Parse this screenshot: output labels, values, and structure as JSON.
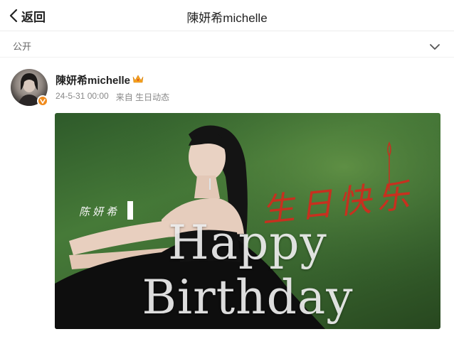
{
  "header": {
    "back_label": "返回",
    "title": "陳妍希michelle"
  },
  "visibility": {
    "label": "公开"
  },
  "post": {
    "author": "陳妍希michelle",
    "timestamp": "24-5-31 00:00",
    "source": "来自 生日动态",
    "image": {
      "caption": "Happy Birthday",
      "signature": "陈妍希",
      "script_text": "生日快乐"
    }
  },
  "colors": {
    "badge": "#f08a1c",
    "crown": "#f4a21d",
    "script": "#c7301f"
  }
}
